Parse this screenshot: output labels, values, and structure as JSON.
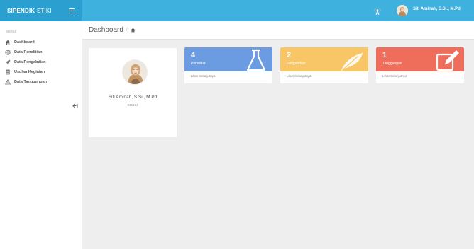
{
  "brand": {
    "bold": "SIPENDIK",
    "light": " STIKI"
  },
  "topbar": {
    "user_name": "Siti Aminah, S.Si., M.Pd"
  },
  "sidebar": {
    "menu_label": "MENU",
    "items": [
      {
        "label": "Dashboard",
        "icon": "home-icon"
      },
      {
        "label": "Data Penelitian",
        "icon": "globe-icon"
      },
      {
        "label": "Data Pengabdian",
        "icon": "rocket-icon"
      },
      {
        "label": "Usulan Kegiatan",
        "icon": "document-icon"
      },
      {
        "label": "Data Tanggungan",
        "icon": "warning-icon"
      }
    ]
  },
  "breadcrumb": {
    "title": "Dashboard",
    "separator": "/"
  },
  "profile": {
    "name": "Siti Aminah, S.Si., M.Pd",
    "id": "010124"
  },
  "stats": [
    {
      "count": "4",
      "label": "Penelitian",
      "link": "Lihat Selanjutnya",
      "color": "#6b9be0",
      "icon": "flask-icon"
    },
    {
      "count": "2",
      "label": "Pengabdian",
      "link": "Lihat Selanjutnya",
      "color": "#f9c667",
      "icon": "feather-icon"
    },
    {
      "count": "1",
      "label": "Tanggungan",
      "link": "Lihat Selanjutnya",
      "color": "#ef6e5b",
      "icon": "edit-icon"
    }
  ],
  "colors": {
    "topbar": "#3fb1de",
    "brand_bg": "#2a9fd0",
    "content_bg": "#eeeeee"
  }
}
